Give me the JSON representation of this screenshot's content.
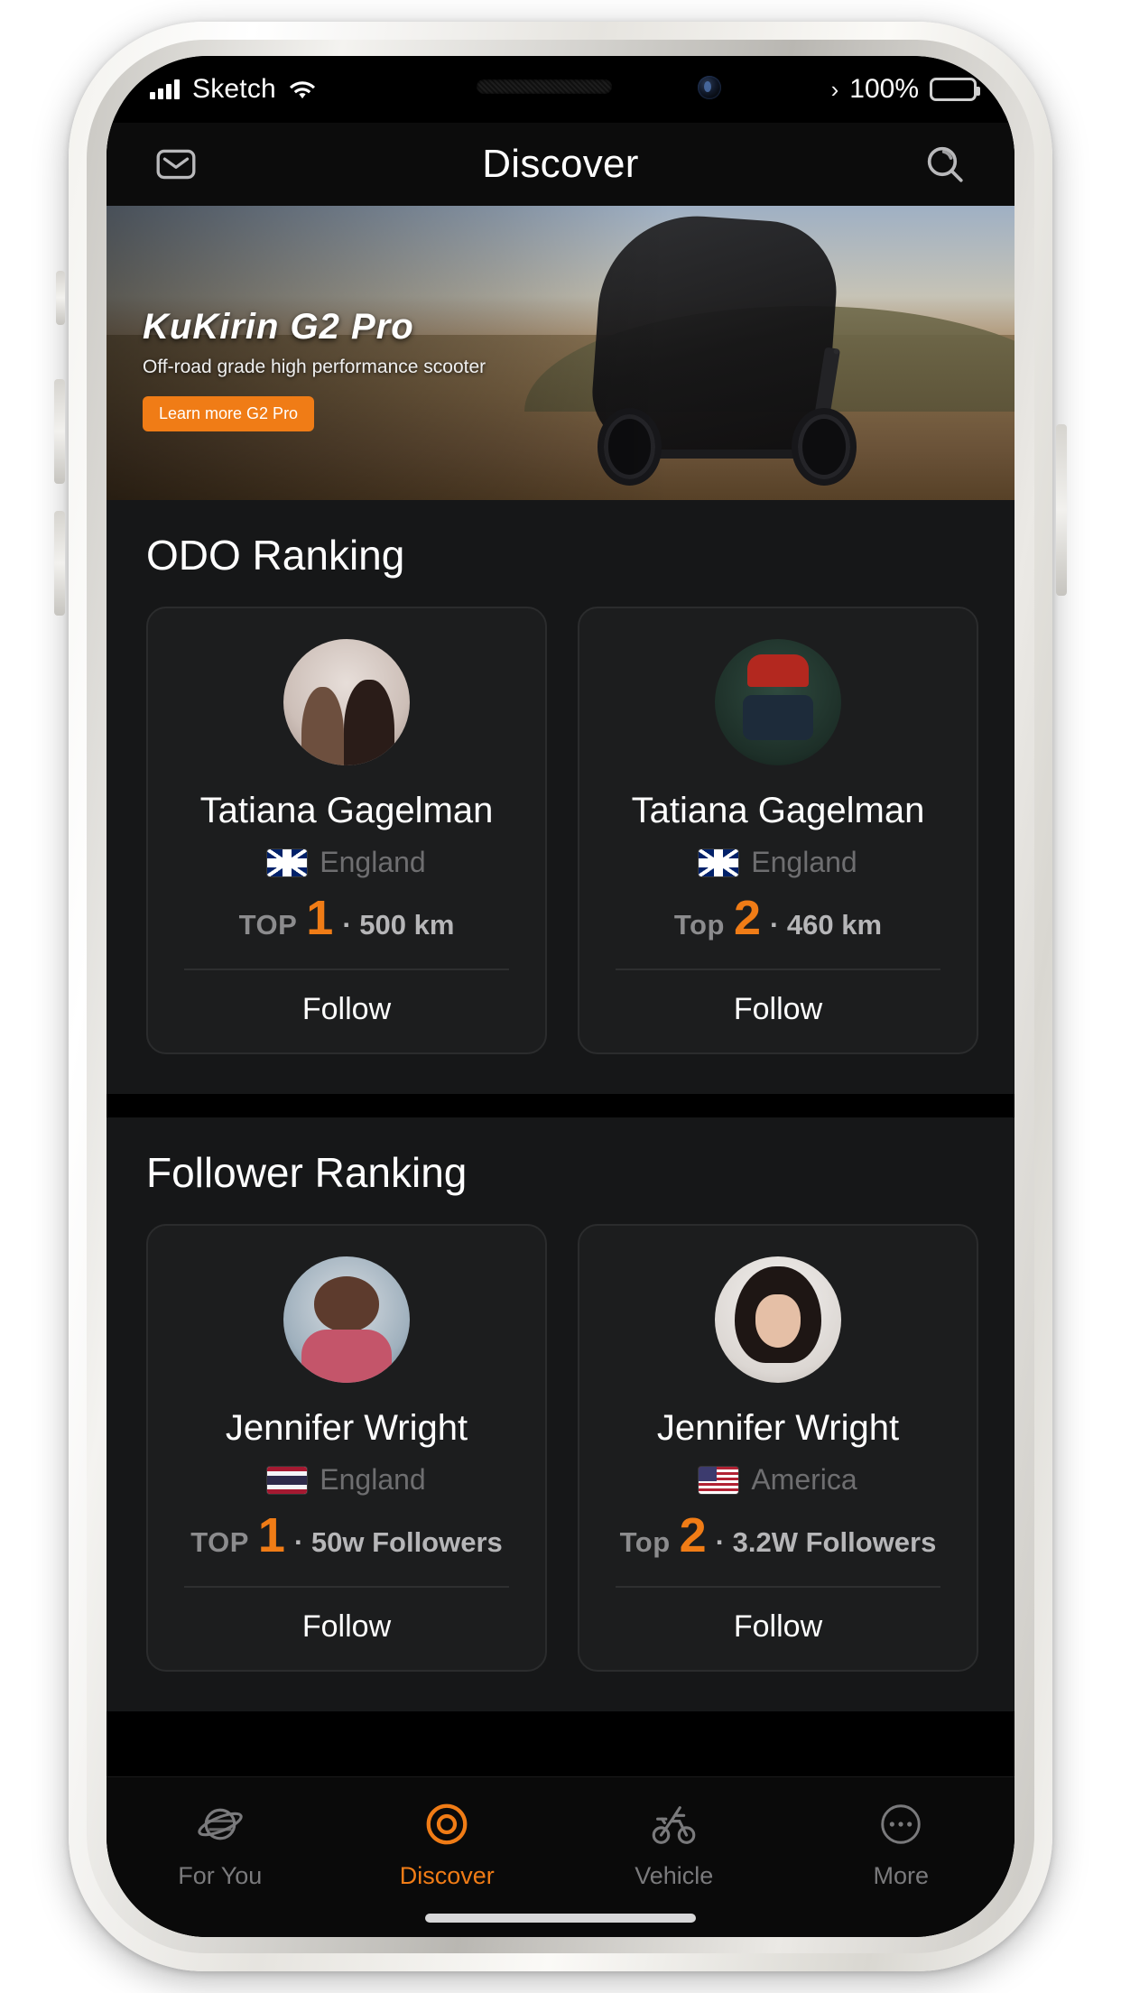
{
  "status_bar": {
    "carrier": "Sketch",
    "signal_icon": "signal-bars-icon",
    "wifi_icon": "wifi-icon",
    "location_chevron": "›",
    "battery_percent": "100%",
    "battery_icon": "battery-full-icon"
  },
  "navbar": {
    "title": "Discover",
    "left_icon": "mail-envelope-icon",
    "right_icon": "search-icon"
  },
  "banner": {
    "title": "KuKirin G2 Pro",
    "subtitle": "Off-road grade high performance scooter",
    "cta_label": "Learn more   G2 Pro",
    "cta_color": "#f07c16"
  },
  "sections": [
    {
      "title": "ODO Ranking",
      "cards": [
        {
          "avatar": "avatar-two-women",
          "name": "Tatiana Gagelman",
          "flag": "flag-uk",
          "country": "England",
          "rank_label": "TOP",
          "rank_num": "1",
          "stat": "· 500 km",
          "follow_label": "Follow"
        },
        {
          "avatar": "avatar-photographer",
          "name": "Tatiana Gagelman",
          "flag": "flag-uk",
          "country": "England",
          "rank_label": "Top",
          "rank_num": "2",
          "stat": "· 460 km",
          "follow_label": "Follow"
        }
      ]
    },
    {
      "title": "Follower Ranking",
      "cards": [
        {
          "avatar": "avatar-man-hoodie",
          "name": "Jennifer Wright",
          "flag": "flag-th",
          "country": "England",
          "rank_label": "TOP",
          "rank_num": "1",
          "stat": "· 50w Followers",
          "follow_label": "Follow"
        },
        {
          "avatar": "avatar-woman-smiling",
          "name": "Jennifer Wright",
          "flag": "flag-us",
          "country": "America",
          "rank_label": "Top",
          "rank_num": "2",
          "stat": "· 3.2W Followers",
          "follow_label": "Follow"
        }
      ]
    }
  ],
  "tabbar": {
    "active_color": "#f07c16",
    "inactive_color": "#7a7a7c",
    "tabs": [
      {
        "label": "For You",
        "icon": "planet-icon",
        "active": false
      },
      {
        "label": "Discover",
        "icon": "target-circle-icon",
        "active": true
      },
      {
        "label": "Vehicle",
        "icon": "bicycle-icon",
        "active": false
      },
      {
        "label": "More",
        "icon": "ellipsis-circle-icon",
        "active": false
      }
    ]
  }
}
